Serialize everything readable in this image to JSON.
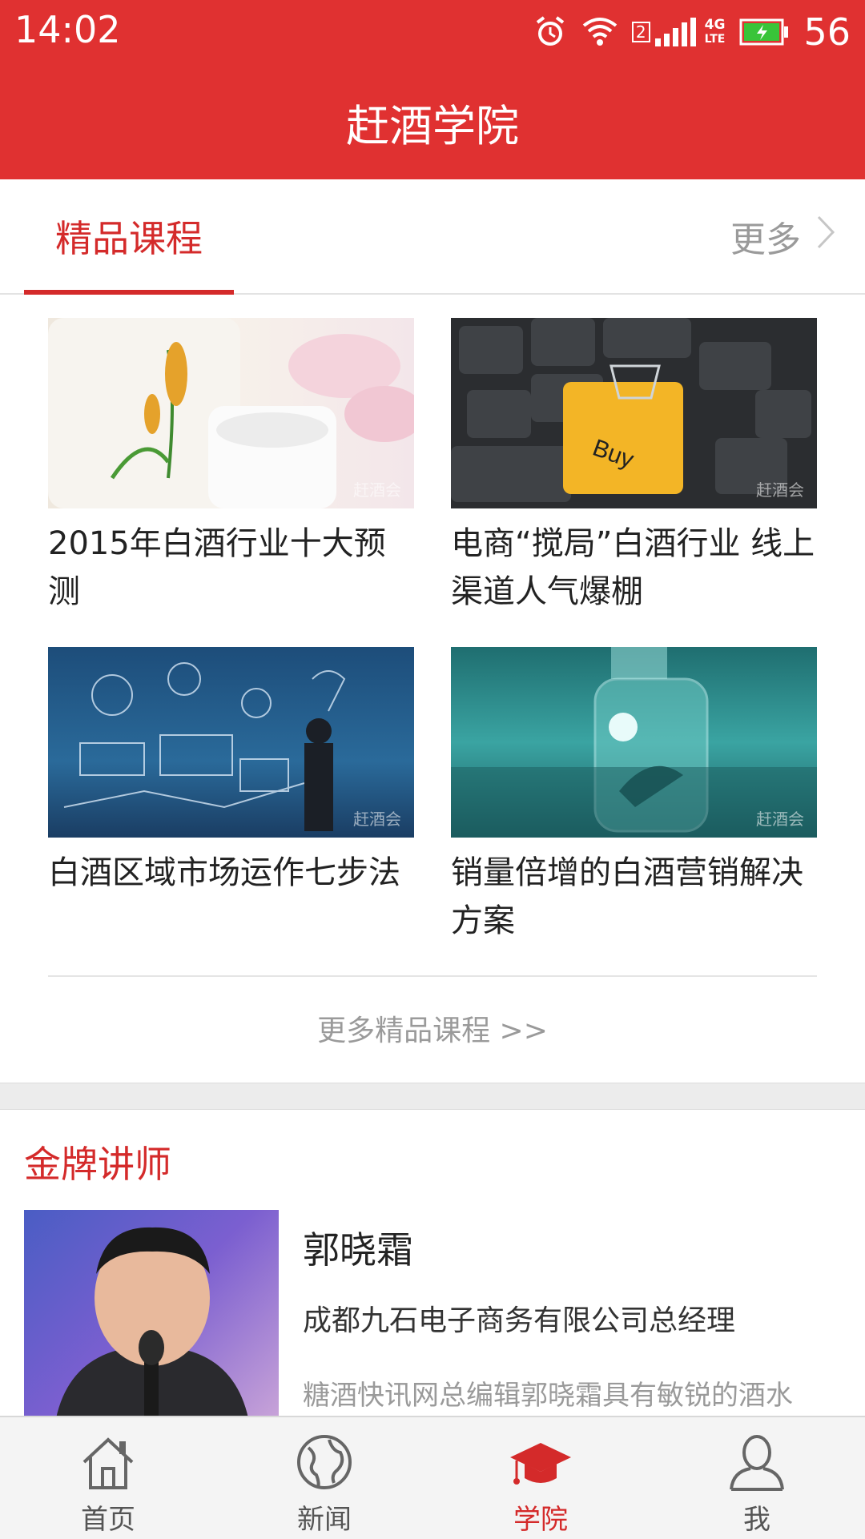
{
  "status_bar": {
    "time": "14:02",
    "sim_slot": "2",
    "network": "4G",
    "network_sub": "LTE",
    "battery": "56",
    "icons": [
      "alarm-icon",
      "wifi-icon",
      "signal-icon",
      "battery-icon"
    ]
  },
  "header": {
    "title": "赶酒学院"
  },
  "section_tabs": {
    "active_tab": "精品课程",
    "more_label": "更多"
  },
  "courses": [
    {
      "title": "2015年白酒行业十大预测",
      "watermark": "赶酒会"
    },
    {
      "title": "电商“搅局”白酒行业 线上渠道人气爆棚",
      "watermark": "赶酒会"
    },
    {
      "title": "白酒区域市场运作七步法",
      "watermark": "赶酒会"
    },
    {
      "title": "销量倍增的白酒营销解决方案",
      "watermark": "赶酒会"
    }
  ],
  "more_courses_label": "更多精品课程 >>",
  "teachers_section": {
    "title": "金牌讲师",
    "teacher": {
      "name": "郭晓霜",
      "company": "成都九石电子商务有限公司总经理",
      "description": "糖酒快讯网总编辑郭晓霜具有敏锐的酒水"
    }
  },
  "bottom_nav": {
    "items": [
      {
        "label": "首页",
        "icon": "home-icon"
      },
      {
        "label": "新闻",
        "icon": "globe-icon"
      },
      {
        "label": "学院",
        "icon": "graduation-cap-icon",
        "active": true
      },
      {
        "label": "我",
        "icon": "user-icon"
      }
    ]
  },
  "colors": {
    "brand_red": "#e03131",
    "accent_red": "#d42a2a"
  }
}
